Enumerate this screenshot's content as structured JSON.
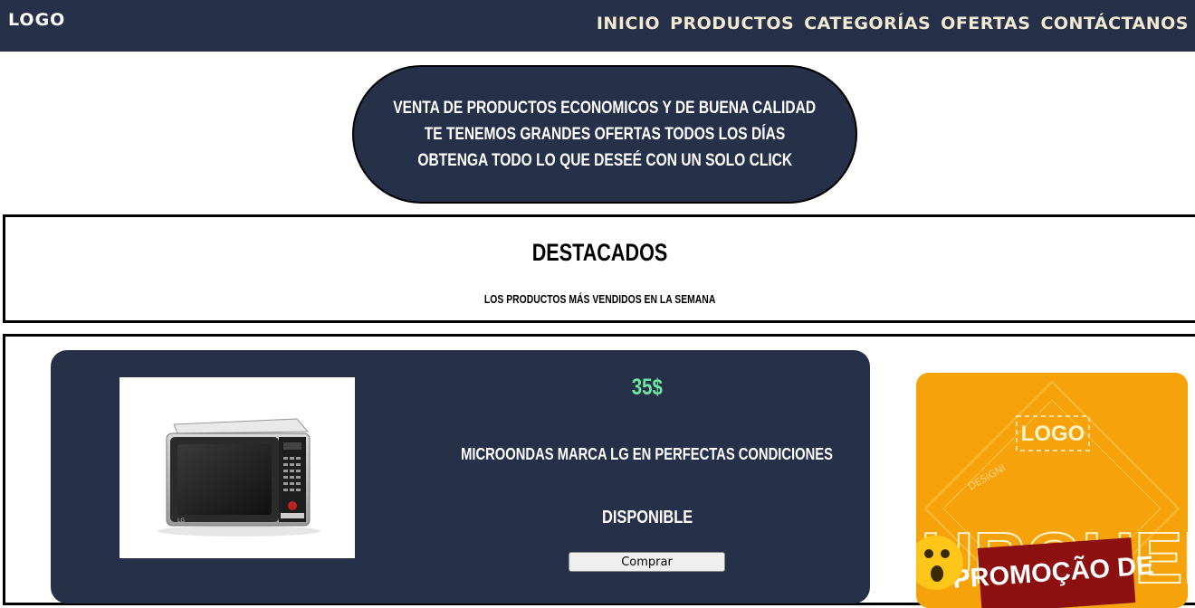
{
  "header": {
    "logo": "LOGO",
    "nav": [
      "INICIO",
      "PRODUCTOS",
      "CATEGORÍAS",
      "OFERTAS",
      "CONTÁCTANOS"
    ]
  },
  "hero": {
    "lines": [
      "VENTA DE PRODUCTOS ECONOMICOS Y DE BUENA CALIDAD",
      "TE TENEMOS GRANDES OFERTAS TODOS LOS DÍAS",
      "OBTENGA TODO LO QUE DESEÉ CON UN SOLO CLICK"
    ]
  },
  "featured": {
    "title": "DESTACADOS",
    "subtitle": "LOS PRODUCTOS MÁS VENDIDOS EN LA SEMANA"
  },
  "product": {
    "price": "35$",
    "description": "MICROONDAS MARCA LG EN PERFECTAS CONDICIONES",
    "availability": "DISPONIBLE",
    "button_label": "Comprar",
    "image_icon": "microwave-image",
    "brand": "LG"
  },
  "promo": {
    "logo": "LOGO",
    "watermark": "DESIGNI",
    "big_word": "BURGUER",
    "banner": "PROMOÇÃO DE"
  },
  "colors": {
    "navy": "#263049",
    "nav_text": "#f2ead2",
    "price": "#6ee6a0",
    "promo_bg": "#f6a20a"
  }
}
